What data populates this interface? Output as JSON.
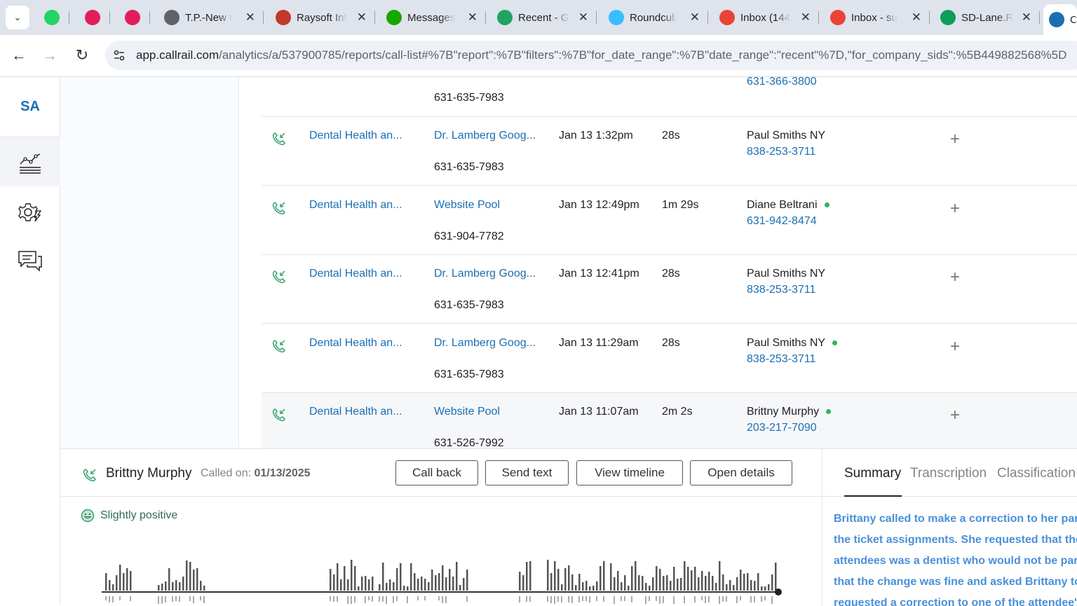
{
  "browser": {
    "tabs": [
      {
        "label": "",
        "icon": "whatsapp-icon",
        "color": "#25d366"
      },
      {
        "label": "",
        "icon": "slack-icon",
        "color": "#e01e5a"
      },
      {
        "label": "",
        "icon": "slack-icon",
        "color": "#e01e5a"
      },
      {
        "label": "T.P.-New t",
        "icon": "globe-icon",
        "color": "#5f6368"
      },
      {
        "label": "Raysoft Inf",
        "icon": "raysoft-icon",
        "color": "#c0392b"
      },
      {
        "label": "Messages",
        "icon": "upwork-icon",
        "color": "#14a800"
      },
      {
        "label": "Recent - G",
        "icon": "google-drive-icon",
        "color": "#1fa463"
      },
      {
        "label": "Roundcub",
        "icon": "roundcube-icon",
        "color": "#37beff"
      },
      {
        "label": "Inbox (144",
        "icon": "gmail-icon",
        "color": "#ea4335"
      },
      {
        "label": "Inbox - su",
        "icon": "gmail-icon",
        "color": "#ea4335"
      },
      {
        "label": "SD-Lane.R",
        "icon": "google-sheets-icon",
        "color": "#0f9d58"
      },
      {
        "label": "C",
        "icon": "callrail-icon",
        "color": "#1a6fb3"
      }
    ],
    "url_host": "app.callrail.com",
    "url_path": "/analytics/a/537900785/reports/call-list#%7B\"report\":%7B\"filters\":%7B\"for_date_range\":%7B\"date_range\":\"recent\"%7D,\"for_company_sids\":%5B449882568%5D"
  },
  "nav": {
    "account_initials": "SA",
    "items": [
      "analytics-icon",
      "settings-icon",
      "messages-icon"
    ]
  },
  "calls": {
    "top_partial": {
      "tracking": "631-635-7983",
      "phone": "631-366-3800"
    },
    "rows": [
      {
        "account": "Dental Health an...",
        "source": "Dr. Lamberg Goog...",
        "tracking": "631-635-7983",
        "datetime": "Jan 13 1:32pm",
        "duration": "28s",
        "caller": "Paul Smiths NY",
        "phone": "838-253-3711",
        "dot": false,
        "add": "+"
      },
      {
        "account": "Dental Health an...",
        "source": "Website Pool",
        "tracking": "631-904-7782",
        "datetime": "Jan 13 12:49pm",
        "duration": "1m 29s",
        "caller": "Diane Beltrani",
        "phone": "631-942-8474",
        "dot": true,
        "add": "+"
      },
      {
        "account": "Dental Health an...",
        "source": "Dr. Lamberg Goog...",
        "tracking": "631-635-7983",
        "datetime": "Jan 13 12:41pm",
        "duration": "28s",
        "caller": "Paul Smiths NY",
        "phone": "838-253-3711",
        "dot": false,
        "add": "+"
      },
      {
        "account": "Dental Health an...",
        "source": "Dr. Lamberg Goog...",
        "tracking": "631-635-7983",
        "datetime": "Jan 13 11:29am",
        "duration": "28s",
        "caller": "Paul Smiths NY",
        "phone": "838-253-3711",
        "dot": true,
        "add": "+"
      },
      {
        "account": "Dental Health an...",
        "source": "Website Pool",
        "tracking": "631-526-7992",
        "datetime": "Jan 13 11:07am",
        "duration": "2m 2s",
        "caller": "Brittny Murphy",
        "phone": "203-217-7090",
        "dot": true,
        "add": "+",
        "highlight": true
      }
    ]
  },
  "detail": {
    "caller_name": "Brittny Murphy",
    "called_on_label": "Called on:",
    "called_on_date": "01/13/2025",
    "buttons": {
      "call_back": "Call back",
      "send_text": "Send text",
      "view_timeline": "View timeline",
      "open_details": "Open details"
    },
    "sentiment": "Slightly positive",
    "tabs": {
      "summary": "Summary",
      "transcription": "Transcription",
      "classification": "Classification"
    },
    "summary_lines": [
      "Brittany called to make a correction to her part",
      "the ticket assignments. She requested that the",
      "attendees was a dentist who would not be part",
      "that the change was fine and asked Brittany to",
      "requested a correction to one of the attendee's"
    ]
  }
}
